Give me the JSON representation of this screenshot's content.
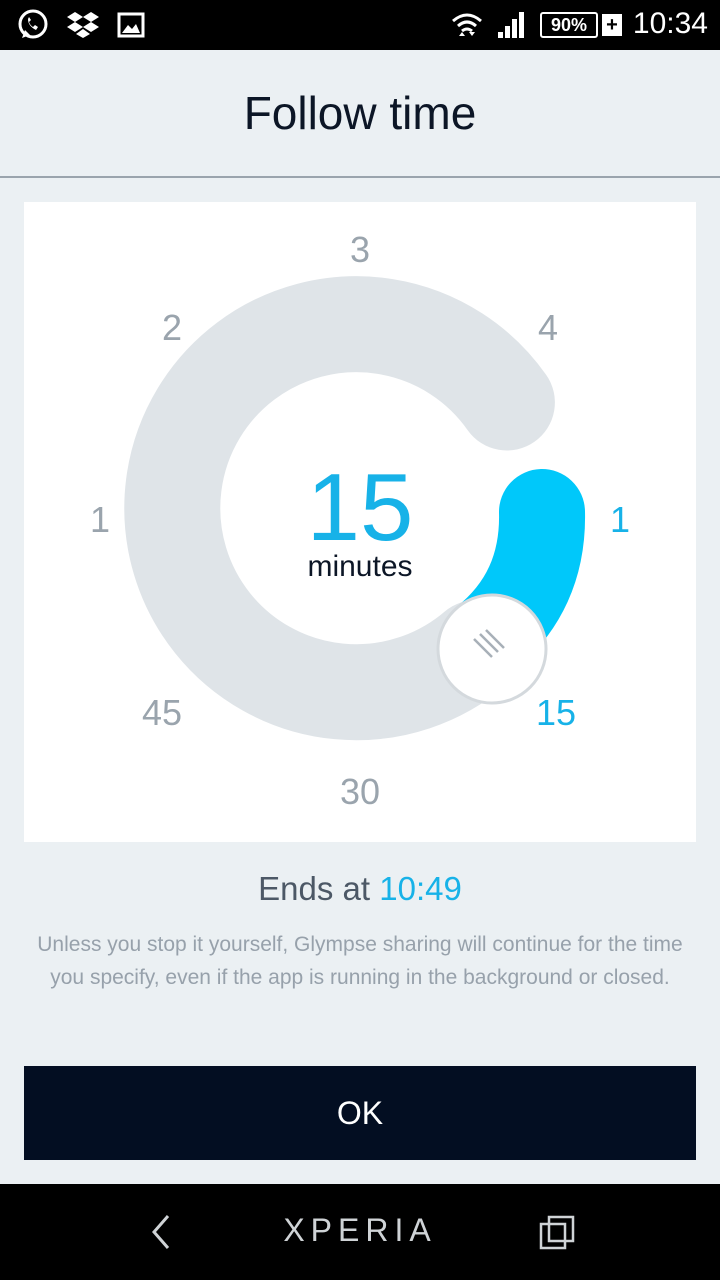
{
  "status_bar": {
    "icons": [
      "whatsapp-icon",
      "dropbox-icon",
      "image-icon",
      "wifi-icon",
      "signal-icon"
    ],
    "battery": "90%",
    "battery_plus": "+",
    "time": "10:34"
  },
  "header": {
    "title": "Follow time"
  },
  "dial": {
    "center_value": "15",
    "center_unit": "minutes",
    "selected_minutes": 15,
    "outer_labels": {
      "l15": "15",
      "l30": "30",
      "l45": "45",
      "l1_left": "1",
      "l2": "2",
      "l3": "3",
      "l4": "4",
      "l1_right": "1"
    },
    "colors": {
      "track": "#dfe4e8",
      "active": "#00c8fa",
      "accent": "#17b2e8"
    }
  },
  "ends": {
    "label": "Ends at",
    "time": "10:49"
  },
  "info_text": "Unless you stop it yourself, Glympse sharing will continue for the time you specify, even if the app is running in the background or closed.",
  "ok_button": {
    "label": "OK"
  },
  "nav_bar": {
    "brand": "XPERIA",
    "icons": [
      "back-icon",
      "recent-apps-icon"
    ]
  }
}
